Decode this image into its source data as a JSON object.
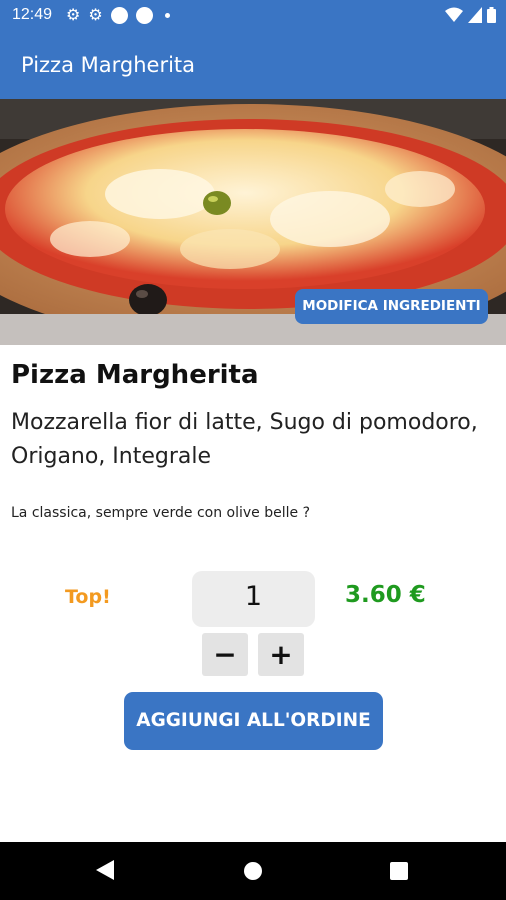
{
  "status_bar": {
    "time": "12:49",
    "icons": [
      "gear-icon",
      "gear-icon",
      "circle-icon",
      "circle-icon",
      "dot-icon",
      "wifi-icon",
      "signal-icon",
      "battery-icon"
    ]
  },
  "app_bar": {
    "title": "Pizza Margherita"
  },
  "hero": {
    "image_subject": "pizza margherita photo",
    "edit_button_label": "MODIFICA INGREDIENTI"
  },
  "product": {
    "name": "Pizza Margherita",
    "ingredients": "Mozzarella fior di latte, Sugo di pomodoro, Origano, Integrale",
    "description": "La classica, sempre verde con olive belle ?",
    "badge": "Top!",
    "quantity": "1",
    "price": "3.60 €"
  },
  "controls": {
    "minus_label": "−",
    "plus_label": "+",
    "add_to_order_label": "AGGIUNGI ALL'ORDINE"
  },
  "colors": {
    "primary": "#3a75c4",
    "price": "#1f9a1f",
    "badge": "#f39a20"
  },
  "nav_bar": {
    "icons": [
      "back-icon",
      "home-icon",
      "recents-icon"
    ]
  }
}
